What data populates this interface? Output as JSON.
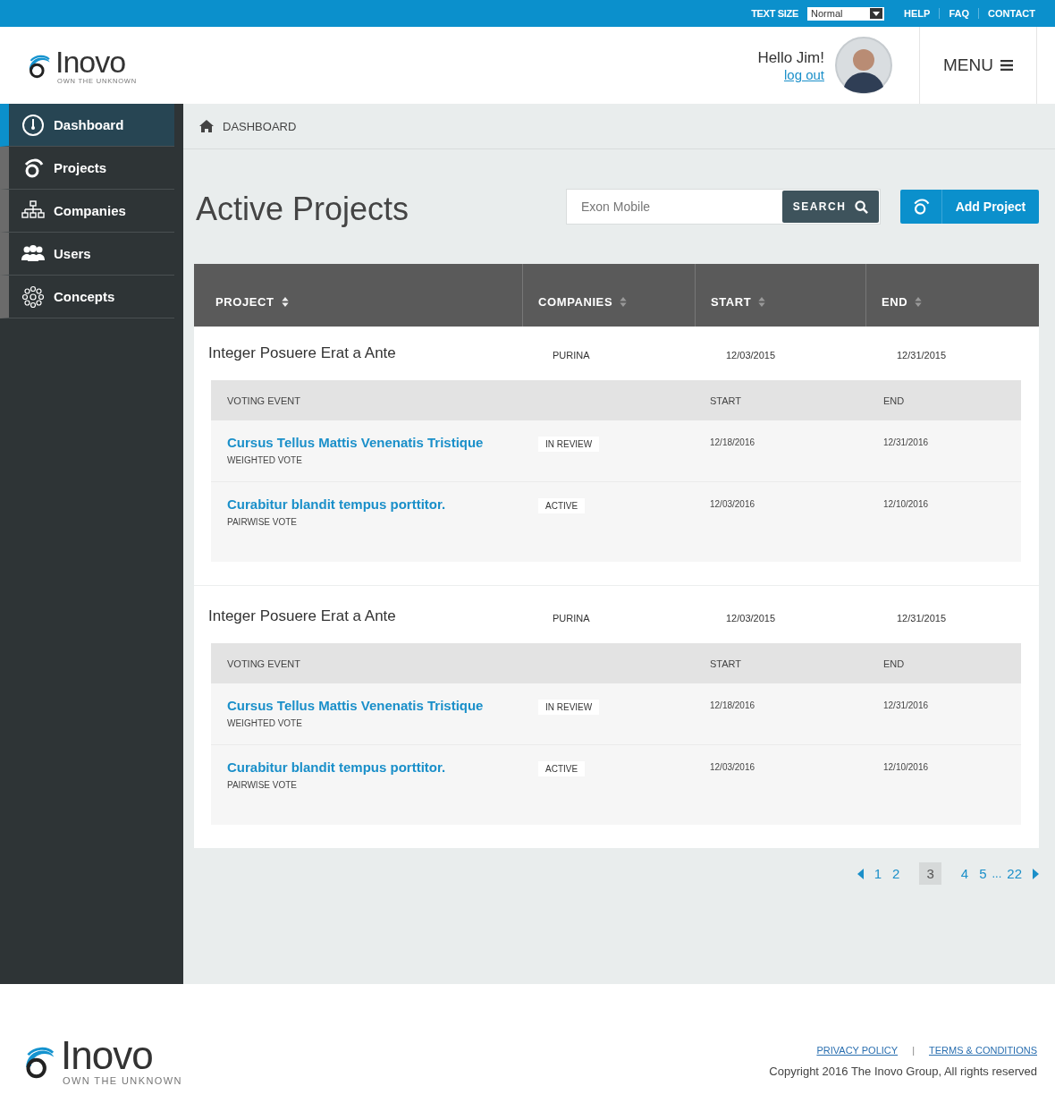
{
  "top_bar": {
    "text_size_label": "TEXT SIZE",
    "text_size_value": "Normal",
    "links": [
      "HELP",
      "FAQ",
      "CONTACT"
    ]
  },
  "header": {
    "logo": {
      "name": "Inovo",
      "tagline": "OWN THE UNKNOWN"
    },
    "greeting": "Hello Jim!",
    "logout": "log out",
    "menu": "MENU"
  },
  "sidebar": {
    "items": [
      {
        "label": "Dashboard",
        "selected": true
      },
      {
        "label": "Projects",
        "selected": false
      },
      {
        "label": "Companies",
        "selected": false
      },
      {
        "label": "Users",
        "selected": false
      },
      {
        "label": "Concepts",
        "selected": false
      }
    ]
  },
  "breadcrumb": "DASHBOARD",
  "page_title": "Active Projects",
  "search": {
    "placeholder": "Exon Mobile",
    "button": "SEARCH"
  },
  "add_button": "Add Project",
  "table": {
    "columns": [
      "PROJECT",
      "COMPANIES",
      "START",
      "END"
    ],
    "projects": [
      {
        "name": "Integer Posuere Erat a Ante",
        "company": "PURINA",
        "start": "12/03/2015",
        "end": "12/31/2015",
        "events_header": {
          "label": "VOTING EVENT",
          "start": "START",
          "end": "END"
        },
        "events": [
          {
            "title": "Cursus Tellus Mattis Venenatis Tristique",
            "type": "WEIGHTED VOTE",
            "status": "IN REVIEW",
            "start": "12/18/2016",
            "end": "12/31/2016"
          },
          {
            "title": "Curabitur blandit tempus porttitor.",
            "type": "PAIRWISE VOTE",
            "status": "ACTIVE",
            "start": "12/03/2016",
            "end": "12/10/2016"
          }
        ]
      },
      {
        "name": "Integer Posuere Erat a Ante",
        "company": "PURINA",
        "start": "12/03/2015",
        "end": "12/31/2015",
        "events_header": {
          "label": "VOTING EVENT",
          "start": "START",
          "end": "END"
        },
        "events": [
          {
            "title": "Cursus Tellus Mattis Venenatis Tristique",
            "type": "WEIGHTED VOTE",
            "status": "IN REVIEW",
            "start": "12/18/2016",
            "end": "12/31/2016"
          },
          {
            "title": "Curabitur blandit tempus porttitor.",
            "type": "PAIRWISE VOTE",
            "status": "ACTIVE",
            "start": "12/03/2016",
            "end": "12/10/2016"
          }
        ]
      }
    ]
  },
  "pagination": {
    "pages": [
      {
        "label": "1",
        "kind": "page",
        "selected": false
      },
      {
        "label": "2",
        "kind": "page",
        "selected": false
      },
      {
        "label": "3",
        "kind": "page",
        "selected": true
      },
      {
        "label": "4",
        "kind": "page",
        "selected": false
      },
      {
        "label": "5",
        "kind": "page",
        "selected": false
      },
      {
        "label": "...",
        "kind": "ellipsis"
      },
      {
        "label": "22",
        "kind": "page",
        "selected": false
      }
    ]
  },
  "footer": {
    "logo": {
      "name": "Inovo",
      "tagline": "OWN THE UNKNOWN"
    },
    "links": [
      "PRIVACY POLICY",
      "TERMS & CONDITIONS"
    ],
    "separator": "|",
    "copyright": "Copyright 2016 The Inovo Group, All rights reserved"
  }
}
